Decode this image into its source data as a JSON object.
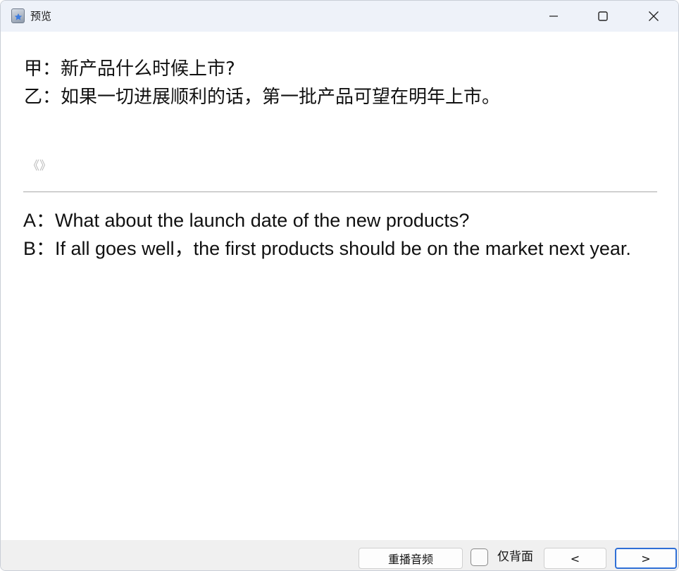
{
  "window": {
    "title": "预览",
    "title_icon": "app-icon",
    "controls": {
      "minimize_icon": "minimize-icon",
      "maximize_icon": "maximize-icon",
      "close_icon": "close-icon"
    }
  },
  "content": {
    "chinese_lines": [
      "甲：新产品什么时候上市?",
      "乙：如果一切进展顺利的话，第一批产品可望在明年上市。"
    ],
    "quote_mark": "《》",
    "english_lines": [
      "A：What about the launch date of the new products?",
      "B：If all goes well，the first products should be on the market next year."
    ]
  },
  "toolbar": {
    "replay_label": "重播音频",
    "back_only_label": "仅背面",
    "back_only_checked": false,
    "prev_label": "<",
    "next_label": ">"
  },
  "colors": {
    "titlebar_bg": "#eef2f9",
    "bottombar_bg": "#f0f0f0",
    "focus_accent": "#2f6fd6"
  }
}
